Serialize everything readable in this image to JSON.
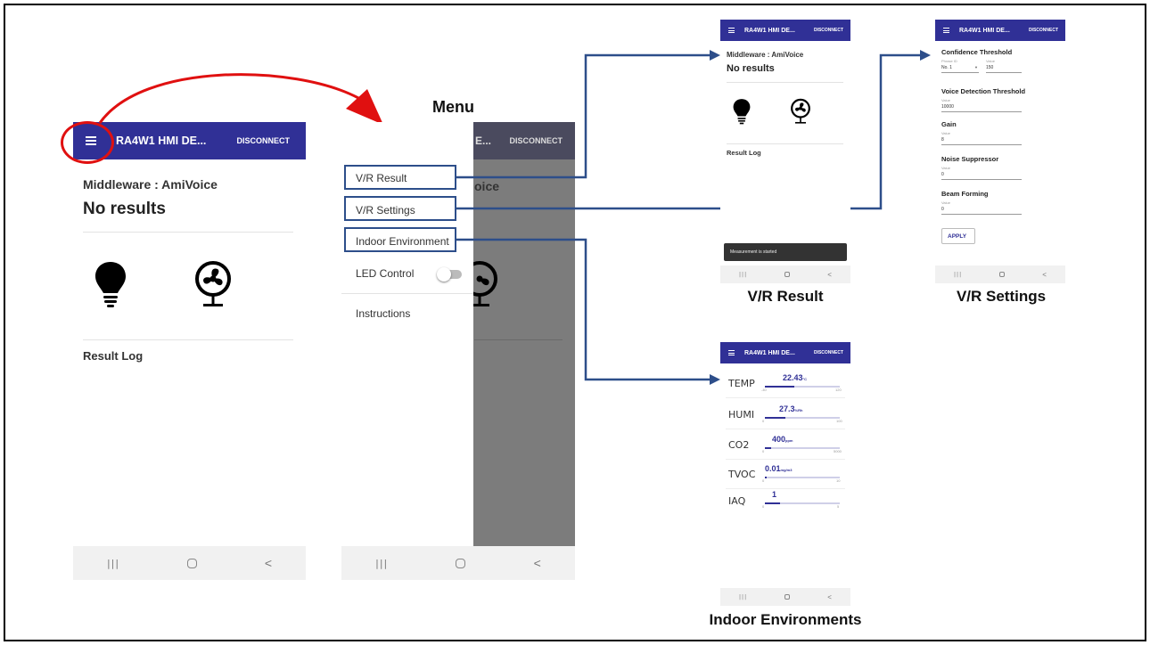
{
  "app": {
    "title": "RA4W1 HMI DE...",
    "disconnect": "DISCONNECT",
    "middleware": "Middleware : AmiVoice",
    "no_results": "No results",
    "result_log": "Result Log",
    "nav": {
      "recent": "|||",
      "back": "<"
    }
  },
  "menu": {
    "heading": "Menu",
    "title_fragment": "E...",
    "voice_fragment": "oice",
    "items": [
      {
        "label": "V/R Result"
      },
      {
        "label": "V/R Settings"
      },
      {
        "label": "Indoor Environment"
      },
      {
        "label": "LED Control"
      },
      {
        "label": "Instructions"
      }
    ]
  },
  "vr_result": {
    "caption": "V/R Result",
    "toast": "Measurement is started"
  },
  "vr_settings": {
    "caption": "V/R Settings",
    "confidence_threshold": "Confidence Threshold",
    "phrase_id_label": "Phrase ID",
    "phrase_id_value": "No. 1",
    "value_label": "Value",
    "confidence_value": "150",
    "voice_detection_threshold": "Voice Detection Threshold",
    "voice_detection_value": "10000",
    "gain": "Gain",
    "gain_value": "8",
    "noise_suppressor": "Noise Suppressor",
    "noise_value": "0",
    "beam_forming": "Beam Forming",
    "beam_value": "0",
    "apply": "APPLY"
  },
  "indoor": {
    "caption": "Indoor Environments",
    "rows": [
      {
        "label": "TEMP",
        "value": "22.43",
        "unit": "°C",
        "min": "-40",
        "max": "120",
        "level": 0.39
      },
      {
        "label": "HUMI",
        "value": "27.3",
        "unit": "%Rh",
        "min": "0",
        "max": "100",
        "level": 0.27
      },
      {
        "label": "CO2",
        "value": "400",
        "unit": "ppm",
        "min": "0",
        "max": "5000",
        "level": 0.08
      },
      {
        "label": "TVOC",
        "value": "0.01",
        "unit": "mg/m3",
        "min": "0",
        "max": "10",
        "level": 0.02
      },
      {
        "label": "IAQ",
        "value": "1",
        "unit": "",
        "min": "0",
        "max": "5",
        "level": 0.2
      }
    ]
  },
  "colors": {
    "appbar": "#303096",
    "connector": "#2d4e8a",
    "highlight": "#e01010"
  }
}
